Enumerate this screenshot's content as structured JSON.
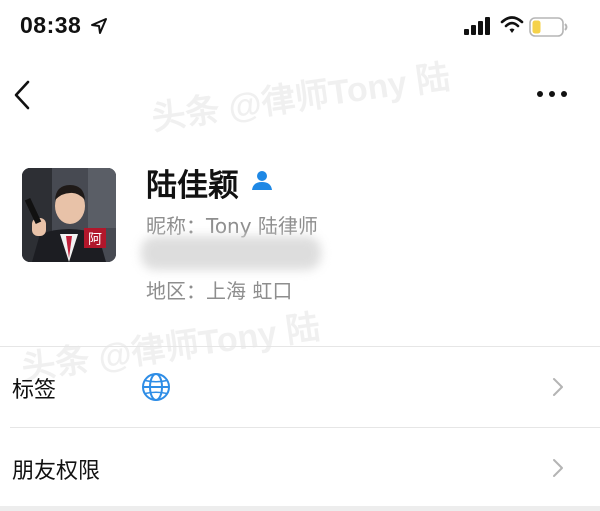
{
  "status_bar": {
    "time": "08:38",
    "location_icon": "location-arrow-icon",
    "signal_icon": "cellular-signal-icon",
    "wifi_icon": "wifi-icon",
    "battery_icon": "battery-icon",
    "battery_color": "#f5d24a"
  },
  "nav": {
    "back_icon": "chevron-left-icon",
    "more_icon": "more-horizontal-icon"
  },
  "profile": {
    "name": "陆佳颖",
    "contact_icon": "person-icon",
    "contact_icon_color": "#1e88e5",
    "nickname": "昵称：Tony 陆律师",
    "region": "地区：上海  虹口",
    "avatar_badge": "阿"
  },
  "list": {
    "rows": [
      {
        "label": "标签",
        "icon": "globe-icon",
        "chevron": "chevron-right-icon"
      },
      {
        "label": "朋友权限",
        "chevron": "chevron-right-icon"
      }
    ]
  },
  "watermark": {
    "text": "头条 @律师Tony 陆"
  }
}
